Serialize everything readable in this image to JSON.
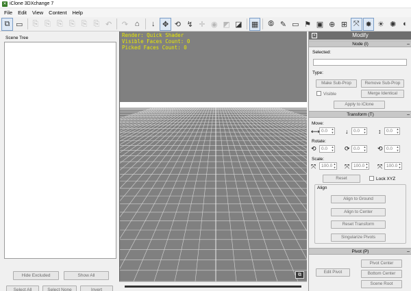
{
  "window": {
    "title": "iClone 3DXchange 7"
  },
  "menubar": {
    "items": [
      "File",
      "Edit",
      "View",
      "Content",
      "Help"
    ]
  },
  "toolbar": {
    "buttons": [
      {
        "name": "scene-tree-icon",
        "glyph": "⧉",
        "active": true
      },
      {
        "name": "open-folder-icon",
        "glyph": "▭"
      },
      {
        "name": "import-icon",
        "glyph": "⎘",
        "dim": true
      },
      {
        "name": "export-icon",
        "glyph": "⎘",
        "dim": true
      },
      {
        "name": "export-prop-icon",
        "glyph": "⎘",
        "dim": true
      },
      {
        "name": "export-avatar-icon",
        "glyph": "⎘",
        "dim": true
      },
      {
        "name": "export-motion-icon",
        "glyph": "⎘",
        "dim": true
      },
      {
        "name": "export-fbx-icon",
        "glyph": "⎘",
        "dim": true
      },
      {
        "name": "undo-icon",
        "glyph": "↶",
        "dim": true
      },
      {
        "name": "redo-icon",
        "glyph": "↷",
        "dim": true
      },
      {
        "name": "home-icon",
        "glyph": "⌂"
      },
      {
        "name": "down-arrow-icon",
        "glyph": "↓"
      },
      {
        "name": "move-icon",
        "glyph": "✥",
        "active": true
      },
      {
        "name": "rotate-icon",
        "glyph": "⟲"
      },
      {
        "name": "transform-icon",
        "glyph": "↯"
      },
      {
        "name": "scale-icon",
        "glyph": "✛",
        "dim": true
      },
      {
        "name": "edit-pivot-icon",
        "glyph": "◉",
        "dim": true
      },
      {
        "name": "edit-mesh-icon",
        "glyph": "◩",
        "dim": true
      },
      {
        "name": "wireframe-icon",
        "glyph": "◪"
      },
      {
        "name": "grid-icon",
        "glyph": "▦",
        "active": true
      },
      {
        "name": "visibility-icon",
        "glyph": "⦾"
      },
      {
        "name": "pen-icon",
        "glyph": "✎"
      },
      {
        "name": "display-icon",
        "glyph": "▭"
      },
      {
        "name": "light-icon",
        "glyph": "⚑"
      },
      {
        "name": "texture-icon",
        "glyph": "▣"
      },
      {
        "name": "globe-icon",
        "glyph": "⊕"
      },
      {
        "name": "camera-icon",
        "glyph": "⊞"
      },
      {
        "name": "axis-icon",
        "glyph": "⤧",
        "active": true
      },
      {
        "name": "sun-light-icon",
        "glyph": "✸",
        "active": true
      },
      {
        "name": "spot-light-icon",
        "glyph": "☀"
      },
      {
        "name": "ambient-light-icon",
        "glyph": "✺"
      },
      {
        "name": "shading-icon",
        "glyph": "◐"
      }
    ]
  },
  "scene_tree": {
    "label": "Scene Tree",
    "buttons": {
      "hide_excluded": "Hide Excluded",
      "show_all": "Show All",
      "select_all": "Select All",
      "select_none": "Select None",
      "invert": "Invert"
    }
  },
  "viewport": {
    "render": "Render: Quick Shader",
    "visible_faces": "Visible Faces Count: 0",
    "picked_faces": "Picked Faces Count: 0",
    "corner_glyph": "⧉"
  },
  "modify": {
    "title": "Modify",
    "node": {
      "header": "Node (I)",
      "selected_label": "Selected:",
      "type_label": "Type:",
      "make_sub_prop": "Make Sub-Prop",
      "remove_sub_prop": "Remove Sub-Prop",
      "visible": "Visible",
      "merge_identical": "Merge Identical",
      "apply": "Apply to iClone"
    },
    "transform": {
      "header": "Transform (T)",
      "move_label": "Move:",
      "rotate_label": "Rotate:",
      "scale_label": "Scale:",
      "move": [
        "0.0",
        "0.0",
        "0.0"
      ],
      "rotate": [
        "0.0",
        "0.0",
        "0.0"
      ],
      "scale": [
        "100.0",
        "100.0",
        "100.0"
      ],
      "reset": "Reset",
      "lock_xyz": "Lock XYZ"
    },
    "align": {
      "label": "Align",
      "to_ground": "Align to Ground",
      "to_center": "Align to Center",
      "reset_transform": "Reset Transform",
      "singularize": "Singularize Pivots"
    },
    "pivot": {
      "header": "Pivot (P)",
      "edit_pivot": "Edit Pivot",
      "pivot_center": "Pivot Center",
      "bottom_center": "Bottom Center",
      "scene_root": "Scene Root"
    }
  },
  "colors": {
    "viewport": "#808080",
    "info_text": "#e8e800",
    "panel_header": "#6e6e6e"
  }
}
